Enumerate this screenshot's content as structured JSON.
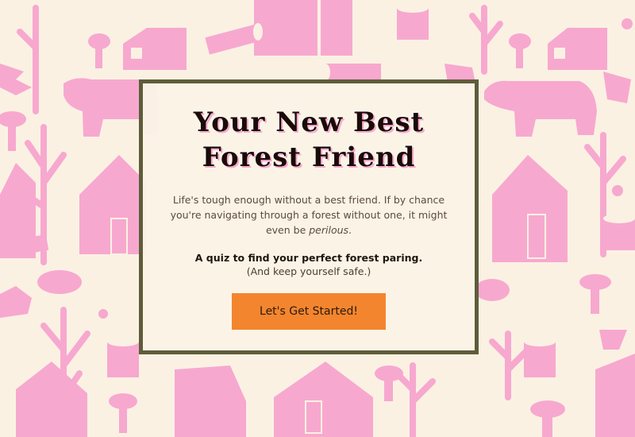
{
  "hero": {
    "title_line1": "Your New Best",
    "title_line2": "Forest Friend",
    "intro_main": "Life's tough enough without a best friend. If by chance you're navigating through a forest without one, it might even be ",
    "intro_emph": "perilous",
    "intro_end": ".",
    "tagline": "A quiz to find your perfect forest paring.",
    "tagline_sub": "(And keep yourself safe.)",
    "cta_label": "Let's Get Started!"
  },
  "colors": {
    "background": "#fbf1e3",
    "pattern_pink": "#f7a8cf",
    "card_border": "#5f5c3a",
    "cta": "#f4852f"
  },
  "background_pattern_icons": [
    "house-icon",
    "bear-icon",
    "tree-icon",
    "mushroom-icon",
    "tree-stump-icon",
    "log-icon",
    "bird-icon",
    "rabbit-icon",
    "hedgehog-icon",
    "acorn-icon"
  ]
}
